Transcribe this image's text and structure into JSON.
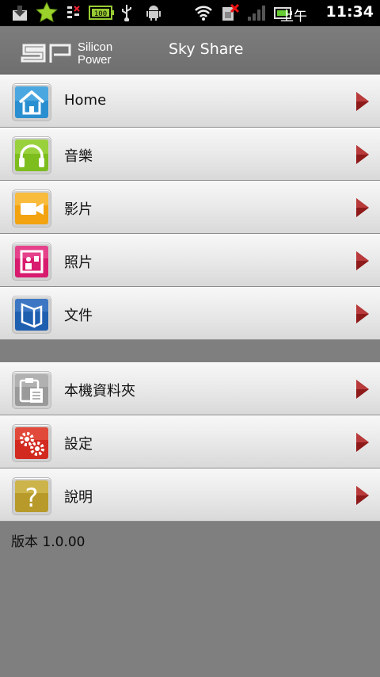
{
  "status_bar": {
    "ampm": "上午",
    "time": "11:34",
    "battery": "100",
    "icons": [
      "download-icon",
      "star-icon",
      "signal-off-icon",
      "battery-indicator-icon",
      "usb-icon",
      "android-icon",
      "wifi-icon",
      "sim-error-icon",
      "cell-signal-icon",
      "battery-icon"
    ]
  },
  "header": {
    "title": "Sky Share",
    "brand_top": "Silicon",
    "brand_bottom": "Power"
  },
  "menu": {
    "items": [
      {
        "label": "Home",
        "icon": "home-icon"
      },
      {
        "label": "音樂",
        "icon": "headphones-icon"
      },
      {
        "label": "影片",
        "icon": "video-camera-icon"
      },
      {
        "label": "照片",
        "icon": "photo-icon"
      },
      {
        "label": "文件",
        "icon": "folder-icon"
      }
    ],
    "tools": [
      {
        "label": "本機資料夾",
        "icon": "clipboard-icon"
      },
      {
        "label": "設定",
        "icon": "gears-icon"
      },
      {
        "label": "說明",
        "icon": "help-icon"
      }
    ]
  },
  "footer": {
    "version": "版本 1.0.00"
  },
  "colors": {
    "arrow": "#8e1a1a",
    "home": "#2a8fd0",
    "music": "#7dbd1e",
    "video": "#f2a30f",
    "photo": "#d81b6e",
    "folder": "#1f5fb0"
  }
}
